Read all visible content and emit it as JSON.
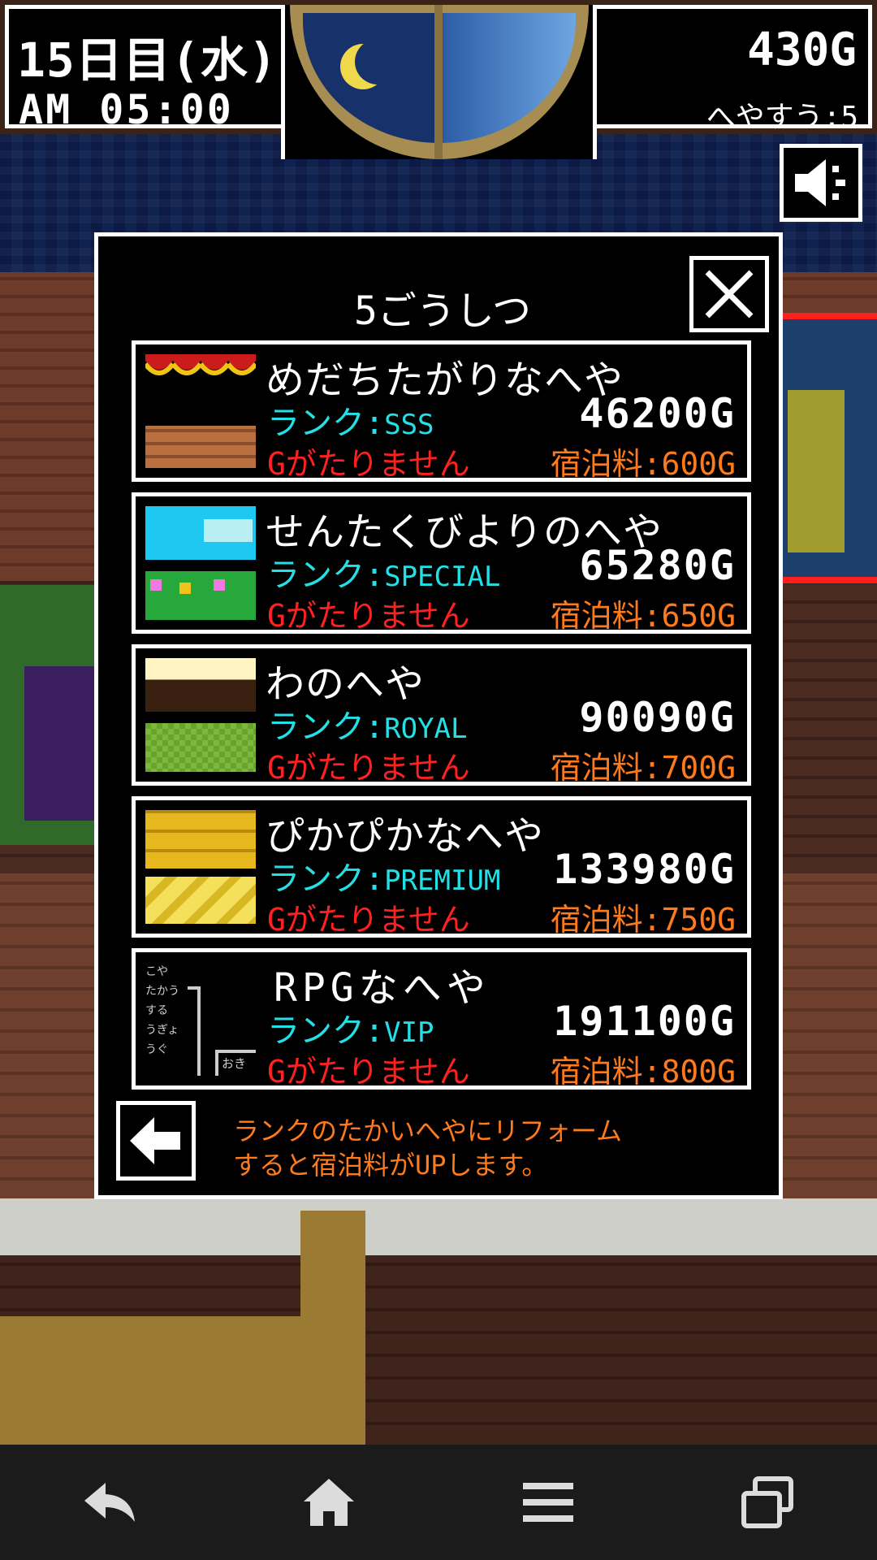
{
  "hud": {
    "day": "15日目(水)",
    "time": "AM 05:00",
    "gold": "430G",
    "rooms": "へやすう:5"
  },
  "modal": {
    "title": "5ごうしつ",
    "hint_line1": "ランクのたかいへやにリフォーム",
    "hint_line2": "すると宿泊料がUPします。",
    "rooms": [
      {
        "name": "めだちたがりなへや",
        "rank_prefix": "ランク:",
        "rank": "SSS",
        "price": "46200G",
        "status": "Gがたりません",
        "fee": "宿泊料:600G"
      },
      {
        "name": "せんたくびよりのへや",
        "rank_prefix": "ランク:",
        "rank": "SPECIAL",
        "price": "65280G",
        "status": "Gがたりません",
        "fee": "宿泊料:650G"
      },
      {
        "name": "わのへや",
        "rank_prefix": "ランク:",
        "rank": "ROYAL",
        "price": "90090G",
        "status": "Gがたりません",
        "fee": "宿泊料:700G"
      },
      {
        "name": "ぴかぴかなへや",
        "rank_prefix": "ランク:",
        "rank": "PREMIUM",
        "price": "133980G",
        "status": "Gがたりません",
        "fee": "宿泊料:750G"
      },
      {
        "name": "RPGなへや",
        "rank_prefix": "ランク:",
        "rank": "VIP",
        "price": "191100G",
        "status": "Gがたりません",
        "fee": "宿泊料:800G"
      }
    ],
    "rpg_thumb": {
      "menu": [
        "こや",
        "たかう",
        "する",
        "うぎょ",
        "うぐ"
      ],
      "tag": "おき"
    }
  },
  "colors": {
    "rank": "#22e0e6",
    "no_gold": "#ff2020",
    "fee": "#ff7a1a",
    "hint": "#ff7a1a"
  },
  "icons": {
    "sound": "speaker-icon",
    "close": "close-icon",
    "back": "arrow-left-icon",
    "nav": [
      "back-icon",
      "home-icon",
      "menu-icon",
      "recent-apps-icon"
    ]
  }
}
